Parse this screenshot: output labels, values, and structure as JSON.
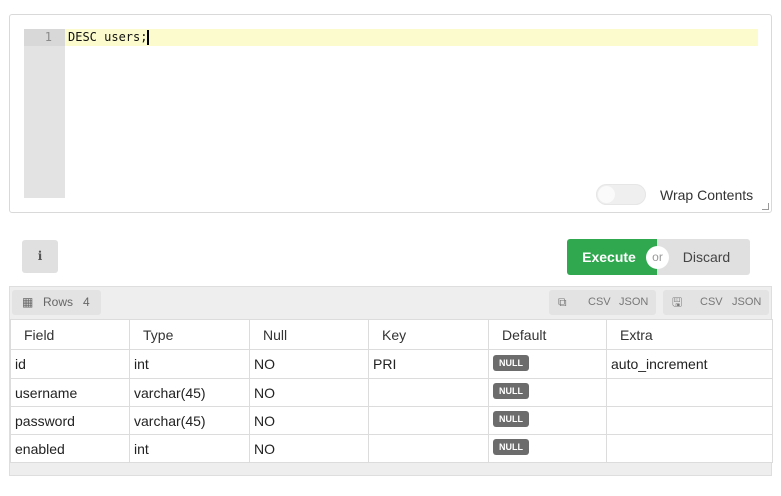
{
  "editor": {
    "line_number": "1",
    "code": "DESC users;",
    "wrap_label": "Wrap Contents",
    "wrap_enabled": false
  },
  "toolbar": {
    "info_label": "i",
    "execute_label": "Execute",
    "or_label": "or",
    "discard_label": "Discard"
  },
  "results": {
    "rows_label": "Rows",
    "rows_count": "4",
    "export_clipboard": {
      "csv": "CSV",
      "json": "JSON"
    },
    "export_download": {
      "csv": "CSV",
      "json": "JSON"
    },
    "columns": [
      "Field",
      "Type",
      "Null",
      "Key",
      "Default",
      "Extra"
    ],
    "rows": [
      [
        "id",
        "int",
        "NO",
        "PRI",
        "NULL",
        "auto_increment"
      ],
      [
        "username",
        "varchar(45)",
        "NO",
        "",
        "NULL",
        ""
      ],
      [
        "password",
        "varchar(45)",
        "NO",
        "",
        "NULL",
        ""
      ],
      [
        "enabled",
        "int",
        "NO",
        "",
        "NULL",
        ""
      ]
    ]
  },
  "colors": {
    "execute": "#2fa84f",
    "active_line": "#fbfbcd",
    "null_badge": "#6c6c6c"
  }
}
